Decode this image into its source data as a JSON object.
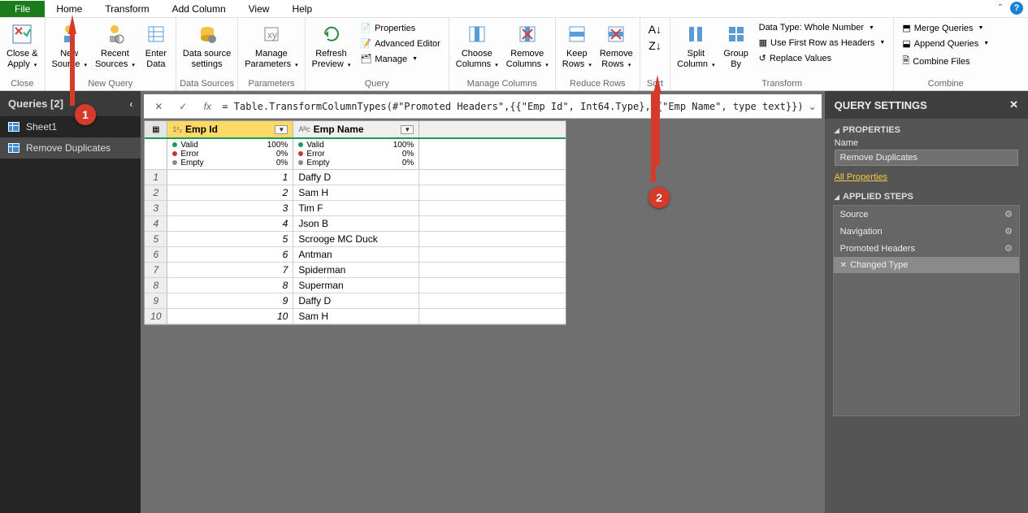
{
  "menu": {
    "file": "File",
    "home": "Home",
    "transform": "Transform",
    "addColumn": "Add Column",
    "view": "View",
    "help": "Help"
  },
  "helpIcon": "?",
  "ribbon": {
    "close": {
      "closeApply": "Close &\nApply",
      "group": "Close"
    },
    "newQuery": {
      "newSource": "New\nSource",
      "recentSources": "Recent\nSources",
      "enterData": "Enter\nData",
      "group": "New Query"
    },
    "dataSources": {
      "dataSourceSettings": "Data source\nsettings",
      "group": "Data Sources"
    },
    "parameters": {
      "manageParameters": "Manage\nParameters",
      "group": "Parameters"
    },
    "query": {
      "refreshPreview": "Refresh\nPreview",
      "properties": "Properties",
      "advancedEditor": "Advanced Editor",
      "manage": "Manage",
      "group": "Query"
    },
    "manageColumns": {
      "chooseColumns": "Choose\nColumns",
      "removeColumns": "Remove\nColumns",
      "group": "Manage Columns"
    },
    "reduceRows": {
      "keepRows": "Keep\nRows",
      "removeRows": "Remove\nRows",
      "group": "Reduce Rows"
    },
    "sort": {
      "group": "Sort"
    },
    "transform": {
      "splitColumn": "Split\nColumn",
      "groupBy": "Group\nBy",
      "dataType": "Data Type: Whole Number",
      "firstRowHeaders": "Use First Row as Headers",
      "replaceValues": "Replace Values",
      "group": "Transform"
    },
    "combine": {
      "mergeQueries": "Merge Queries",
      "appendQueries": "Append Queries",
      "combineFiles": "Combine Files",
      "group": "Combine"
    }
  },
  "queriesPane": {
    "title": "Queries [2]",
    "items": [
      "Sheet1",
      "Remove Duplicates"
    ]
  },
  "formulaBar": {
    "text": "= Table.TransformColumnTypes(#\"Promoted Headers\",{{\"Emp Id\", Int64.Type}, {\"Emp Name\", type text}})"
  },
  "grid": {
    "columns": [
      {
        "type": "1²₃",
        "name": "Emp Id"
      },
      {
        "type": "Aᴮc",
        "name": "Emp Name"
      }
    ],
    "quality": {
      "valid": "Valid",
      "error": "Error",
      "empty": "Empty",
      "validPct": "100%",
      "errorPct": "0%",
      "emptyPct": "0%"
    },
    "rows": [
      {
        "n": "1",
        "id": "1",
        "name": "Daffy D"
      },
      {
        "n": "2",
        "id": "2",
        "name": "Sam H"
      },
      {
        "n": "3",
        "id": "3",
        "name": "Tim F"
      },
      {
        "n": "4",
        "id": "4",
        "name": "Json B"
      },
      {
        "n": "5",
        "id": "5",
        "name": "Scrooge MC Duck"
      },
      {
        "n": "6",
        "id": "6",
        "name": "Antman"
      },
      {
        "n": "7",
        "id": "7",
        "name": "Spiderman"
      },
      {
        "n": "8",
        "id": "8",
        "name": "Superman"
      },
      {
        "n": "9",
        "id": "9",
        "name": "Daffy D"
      },
      {
        "n": "10",
        "id": "10",
        "name": "Sam H"
      }
    ]
  },
  "settings": {
    "title": "QUERY SETTINGS",
    "propertiesSection": "PROPERTIES",
    "nameLabel": "Name",
    "nameValue": "Remove Duplicates",
    "allProps": "All Properties",
    "stepsSection": "APPLIED STEPS",
    "steps": [
      {
        "name": "Source",
        "gear": true
      },
      {
        "name": "Navigation",
        "gear": true
      },
      {
        "name": "Promoted Headers",
        "gear": true
      },
      {
        "name": "Changed Type",
        "gear": false,
        "selected": true
      }
    ]
  },
  "callouts": {
    "b1": "1",
    "b2": "2"
  }
}
